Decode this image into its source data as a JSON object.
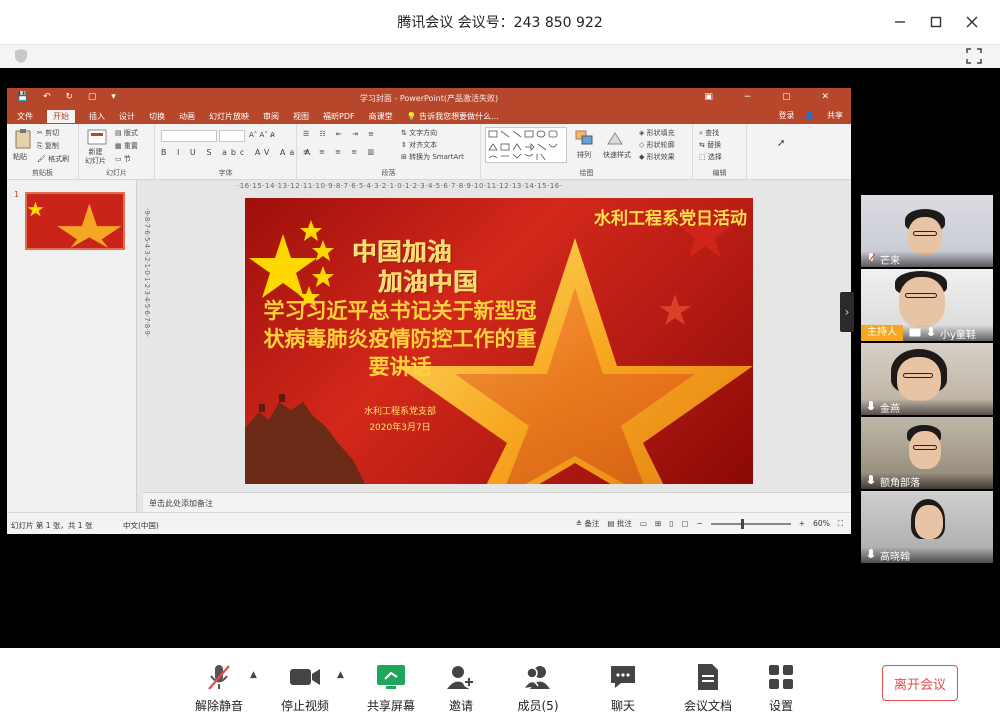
{
  "window": {
    "title": "腾讯会议 会议号：243 850 922",
    "controls": [
      "minimize-icon",
      "maximize-icon",
      "close-icon"
    ]
  },
  "ppt": {
    "title": "学习封面 - PowerPoint(产品激活失败)",
    "tabs": [
      "文件",
      "开始",
      "插入",
      "设计",
      "切换",
      "动画",
      "幻灯片放映",
      "审阅",
      "视图",
      "福昕PDF",
      "商课堂"
    ],
    "active_tab": "开始",
    "tell_me": "告诉我您想要做什么...",
    "login": "登录",
    "share": "共享",
    "ribbon": {
      "clipboard": {
        "label": "剪贴板",
        "paste": "粘贴",
        "cut": "剪切",
        "copy": "复制",
        "format_painter": "格式刷"
      },
      "slides": {
        "label": "幻灯片",
        "new_slide": "新建\n幻灯片",
        "layout": "版式",
        "reset": "重置",
        "section": "节"
      },
      "font": {
        "label": "字体"
      },
      "paragraph": {
        "label": "段落",
        "text_direction": "文字方向",
        "align_text": "对齐文本",
        "smartart": "转换为 SmartArt"
      },
      "drawing": {
        "label": "绘图",
        "arrange": "排列",
        "quick_styles": "快速样式",
        "shape_fill": "形状填充",
        "shape_outline": "形状轮廓",
        "shape_effects": "形状效果"
      },
      "editing": {
        "label": "编辑",
        "find": "查找",
        "replace": "替换",
        "select": "选择"
      }
    },
    "ruler_top": "·16·15·14·13·12·11·10·9·8·7·6·5·4·3·2·1·0·1·2·3·4·5·6·7·8·9·10·11·12·13·14·15·16·",
    "ruler_left": "·9·8·7·6·5·4·3·2·1·0·1·2·3·4·5·6·7·8·9·",
    "slide_number": "1",
    "slide": {
      "header": "水利工程系党日活动",
      "cheer_line1": "中国加油",
      "cheer_line2": "加油中国",
      "main_title": "学习习近平总书记关于新型冠状病毒肺炎疫情防控工作的重要讲话",
      "org": "水利工程系党支部",
      "date": "2020年3月7日"
    },
    "notes_placeholder": "单击此处添加备注",
    "status": {
      "slide_info": "幻灯片 第 1 张，共 1 张",
      "language": "中文(中国)",
      "notes": "备注",
      "comments": "批注",
      "zoom": "60%"
    }
  },
  "participants": [
    {
      "name": "芒来",
      "host": false
    },
    {
      "name": "小y童鞋",
      "host": true,
      "host_label": "主持人"
    },
    {
      "name": "金燕",
      "host": false
    },
    {
      "name": "额角部落",
      "host": false
    },
    {
      "name": "高晓翰",
      "host": false
    }
  ],
  "toolbar": {
    "unmute": "解除静音",
    "stop_video": "停止视频",
    "share_screen": "共享屏幕",
    "invite": "邀请",
    "members": "成员(5)",
    "chat": "聊天",
    "docs": "会议文档",
    "settings": "设置",
    "leave": "离开会议"
  },
  "colors": {
    "ppt_accent": "#b7472a",
    "share_green": "#1ea65a",
    "leave_red": "#e0504a",
    "host_badge": "#f5a623"
  }
}
